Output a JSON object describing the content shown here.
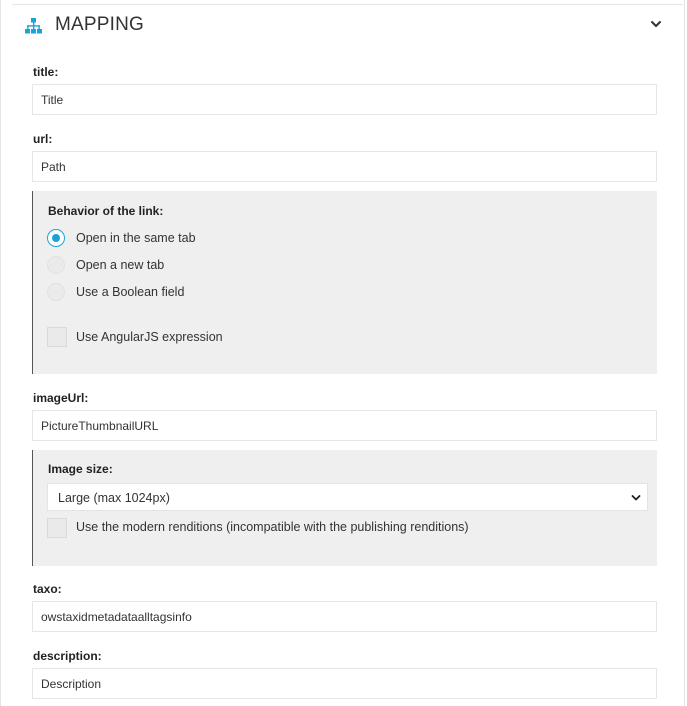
{
  "panel": {
    "title": "MAPPING",
    "icon": "sitemap-icon",
    "collapse_icon": "chevron-down-icon"
  },
  "colors": {
    "accent": "#1aa3d9",
    "subbox_bg": "#efefef",
    "subbox_border": "#555555"
  },
  "fields": {
    "title": {
      "label": "title:",
      "value": "Title"
    },
    "url": {
      "label": "url:",
      "value": "Path"
    },
    "imageUrl": {
      "label": "imageUrl:",
      "value": "PictureThumbnailURL"
    },
    "taxo": {
      "label": "taxo:",
      "value": "owstaxidmetadataalltagsinfo"
    },
    "description": {
      "label": "description:",
      "value": "Description"
    }
  },
  "link_behavior": {
    "label": "Behavior of the link:",
    "options": [
      {
        "label": "Open in the same tab",
        "checked": true
      },
      {
        "label": "Open a new tab",
        "checked": false
      },
      {
        "label": "Use a Boolean field",
        "checked": false
      }
    ],
    "angular_checkbox": {
      "label": "Use AngularJS expression",
      "checked": false
    }
  },
  "image_size": {
    "label": "Image size:",
    "selected": "Large (max 1024px)",
    "modern_checkbox": {
      "label": "Use the modern renditions (incompatible with the publishing renditions)",
      "checked": false
    }
  }
}
